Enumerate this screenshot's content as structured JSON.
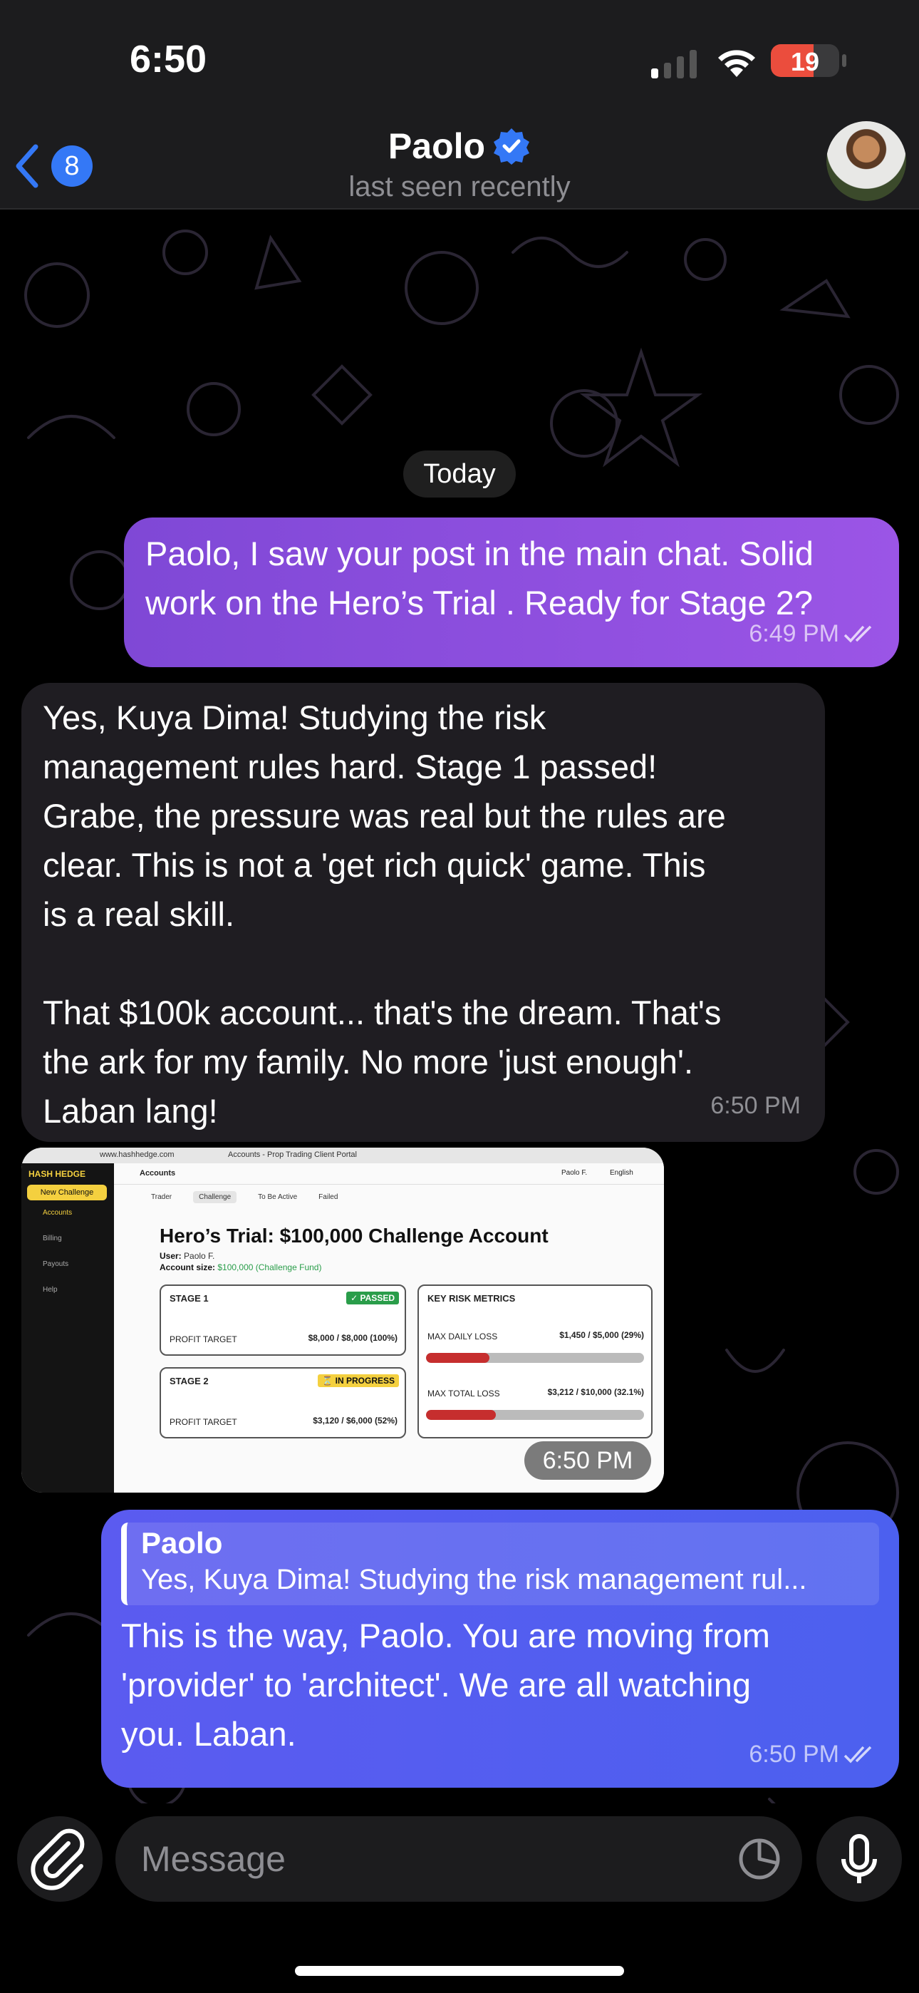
{
  "status_bar": {
    "time": "6:50",
    "battery": "19"
  },
  "header": {
    "back_badge": "8",
    "name": "Paolo",
    "status": "last seen recently"
  },
  "date_separator": "Today",
  "messages": [
    {
      "direction": "outgoing",
      "text": "Paolo, I saw your post in the main chat. Solid\nwork on the Hero’s Trial . Ready for Stage 2?",
      "time": "6:49 PM"
    },
    {
      "direction": "incoming",
      "text": "Yes, Kuya Dima! Studying the risk\nmanagement rules hard. Stage 1 passed!\nGrabe, the pressure was real but the rules are\nclear. This is not a 'get rich quick' game. This\nis a real skill.\n\nThat $100k account... that's the dream. That's\nthe ark for my family. No more 'just enough'.\nLaban lang!",
      "time": "6:50 PM"
    },
    {
      "direction": "incoming",
      "type": "photo",
      "time": "6:50 PM",
      "screenshot": {
        "url": "www.hashhedge.com",
        "tab_title": "Accounts - Prop Trading Client Portal",
        "brand": "HASH HEDGE",
        "new_challenge": "New Challenge",
        "sidebar": [
          "Accounts",
          "Billing",
          "Payouts",
          "Help"
        ],
        "page": "Accounts",
        "user_short": "Paolo F.",
        "language": "English",
        "tabs": [
          "Trader",
          "Challenge",
          "To Be Active",
          "Failed"
        ],
        "title": "Hero’s Trial: $100,000 Challenge Account",
        "user_label": "User:",
        "user_value": "Paolo F.",
        "size_label": "Account size:",
        "size_value": "$100,000 (Challenge Fund)",
        "stage1": {
          "title": "STAGE 1",
          "status": "PASSED",
          "label": "PROFIT TARGET",
          "value": "$8,000 / $8,000 (100%)"
        },
        "stage2": {
          "title": "STAGE 2",
          "status": "IN PROGRESS",
          "label": "PROFIT TARGET",
          "value": "$3,120 / $6,000 (52%)"
        },
        "risk": {
          "title": "KEY RISK METRICS",
          "daily_label": "MAX DAILY LOSS",
          "daily_value": "$1,450 / $5,000 (29%)",
          "daily_pct": 29,
          "total_label": "MAX TOTAL LOSS",
          "total_value": "$3,212 / $10,000 (32.1%)",
          "total_pct": 32.1
        }
      }
    },
    {
      "direction": "outgoing",
      "reply_to": {
        "name": "Paolo",
        "text": "Yes, Kuya Dima! Studying the risk management rul..."
      },
      "text": "This is the way, Paolo. You are moving from\n'provider' to 'architect'. We are all watching\nyou. Laban.",
      "time": "6:50 PM"
    }
  ],
  "input": {
    "placeholder": "Message"
  },
  "colors": {
    "accent": "#3478f6",
    "outgoing_purple": "#8a4fe0",
    "outgoing_blue": "#5660ef",
    "incoming": "#1f1d22"
  }
}
